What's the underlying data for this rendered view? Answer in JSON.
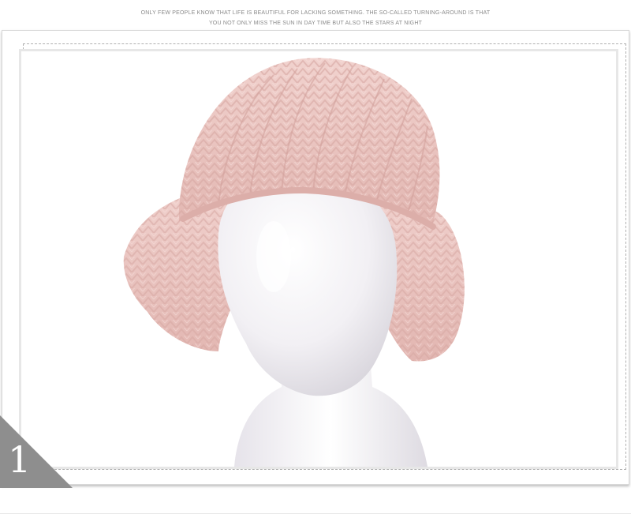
{
  "tagline": {
    "line1": "ONLY FEW PEOPLE KNOW THAT LIFE IS BEAUTIFUL FOR LACKING SOMETHING. THE SO-CALLED TURNING-AROUND IS THAT",
    "line2": "YOU NOT ONLY MISS THE SUN IN DAY TIME BUT ALSO THE STARS AT NIGHT"
  },
  "photo": {
    "subject": "pink-knit-bucket-hat-on-mannequin",
    "colors": {
      "hat": "#e9c2be",
      "hat_shadow": "#d9a9a4",
      "mannequin": "#f3f1f5"
    }
  },
  "badge": {
    "number": "1",
    "color": "#8e8e8e"
  }
}
